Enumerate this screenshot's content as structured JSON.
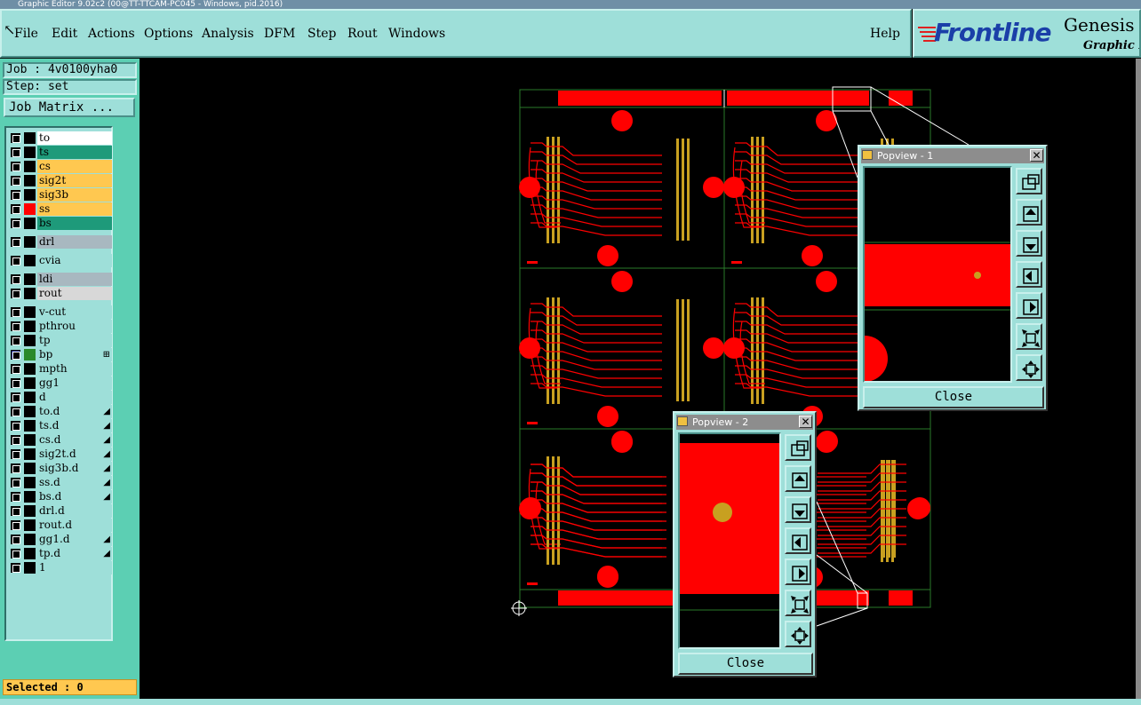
{
  "window": {
    "title": "Graphic Editor 9.02c2 (00@TT-TTCAM-PC045 - Windows, pid.2016)"
  },
  "menu": {
    "items": [
      {
        "id": "file",
        "label": "File"
      },
      {
        "id": "edit",
        "label": "Edit"
      },
      {
        "id": "actions",
        "label": "Actions"
      },
      {
        "id": "options",
        "label": "Options"
      },
      {
        "id": "analysis",
        "label": "Analysis"
      },
      {
        "id": "dfm",
        "label": "DFM"
      },
      {
        "id": "step",
        "label": "Step"
      },
      {
        "id": "rout",
        "label": "Rout"
      },
      {
        "id": "windows",
        "label": "Windows"
      },
      {
        "id": "help",
        "label": "Help"
      }
    ]
  },
  "brand": {
    "logo_text": "Frontline",
    "product": "Genesis",
    "subtitle": "Graphic Ed"
  },
  "job": {
    "job_label": "Job : 4v0100yha0",
    "step_label": "Step: set",
    "matrix_button": "Job Matrix ..."
  },
  "layers": [
    {
      "name": "to",
      "color": "#ffffff",
      "swatch": "#000000"
    },
    {
      "name": "ts",
      "color": "#1e9a7a",
      "swatch": "#000000"
    },
    {
      "name": "cs",
      "color": "#ffc850",
      "swatch": "#000000"
    },
    {
      "name": "sig2t",
      "color": "#ffc850",
      "swatch": "#000000"
    },
    {
      "name": "sig3b",
      "color": "#ffc850",
      "swatch": "#000000"
    },
    {
      "name": "ss",
      "color": "#ffc850",
      "swatch": "#ff0000"
    },
    {
      "name": "bs",
      "color": "#1e9a7a",
      "swatch": "#000000"
    },
    {
      "name": "drl",
      "color": "#a8b8c0",
      "swatch": "#000000"
    },
    {
      "name": "cvia",
      "color": "#9edfd9",
      "swatch": "#000000"
    },
    {
      "name": "ldi",
      "color": "#a8b8c0",
      "swatch": "#000000"
    },
    {
      "name": "rout",
      "color": "#d8d8d8",
      "swatch": "#000000"
    },
    {
      "name": "v-cut",
      "color": "#9edfd9",
      "swatch": "#000000"
    },
    {
      "name": "pthrou",
      "color": "#9edfd9",
      "swatch": "#000000"
    },
    {
      "name": "tp",
      "color": "#9edfd9",
      "swatch": "#000000"
    },
    {
      "name": "bp",
      "color": "#9edfd9",
      "swatch": "#2a8a2a",
      "checkbox": "#1a2a8a",
      "extra": "⊞"
    },
    {
      "name": "mpth",
      "color": "#9edfd9",
      "swatch": "#000000"
    },
    {
      "name": "gg1",
      "color": "#9edfd9",
      "swatch": "#000000"
    },
    {
      "name": "d",
      "color": "#9edfd9",
      "swatch": "#000000"
    },
    {
      "name": "to.d",
      "color": "#9edfd9",
      "swatch": "#000000",
      "extra": "◢"
    },
    {
      "name": "ts.d",
      "color": "#9edfd9",
      "swatch": "#000000",
      "extra": "◢"
    },
    {
      "name": "cs.d",
      "color": "#9edfd9",
      "swatch": "#000000",
      "extra": "◢"
    },
    {
      "name": "sig2t.d",
      "color": "#9edfd9",
      "swatch": "#000000",
      "extra": "◢"
    },
    {
      "name": "sig3b.d",
      "color": "#9edfd9",
      "swatch": "#000000",
      "extra": "◢"
    },
    {
      "name": "ss.d",
      "color": "#9edfd9",
      "swatch": "#000000",
      "extra": "◢"
    },
    {
      "name": "bs.d",
      "color": "#9edfd9",
      "swatch": "#000000",
      "extra": "◢"
    },
    {
      "name": "drl.d",
      "color": "#9edfd9",
      "swatch": "#000000"
    },
    {
      "name": "rout.d",
      "color": "#9edfd9",
      "swatch": "#000000"
    },
    {
      "name": "gg1.d",
      "color": "#9edfd9",
      "swatch": "#000000",
      "extra": "◢"
    },
    {
      "name": "tp.d",
      "color": "#9edfd9",
      "swatch": "#000000",
      "extra": "◢"
    },
    {
      "name": "1",
      "color": "#9edfd9",
      "swatch": "#000000"
    }
  ],
  "status": {
    "selected": "Selected : 0"
  },
  "popview1": {
    "title": "Popview - 1",
    "close_label": "Close",
    "close_x": "✕"
  },
  "popview2": {
    "title": "Popview - 2",
    "close_label": "Close",
    "close_x": "✕"
  },
  "popview_tools": [
    "zoom-fit-icon",
    "pan-up-icon",
    "pan-down-icon",
    "pan-left-icon",
    "pan-right-icon",
    "zoom-out-icon",
    "zoom-in-icon"
  ],
  "colors": {
    "panel": "#9edfd9",
    "panel_dark": "#5ccfb3",
    "copper": "#ff0000",
    "pad": "#c8a020",
    "outline": "#2a7a2a",
    "selected_bg": "#ffc850"
  }
}
